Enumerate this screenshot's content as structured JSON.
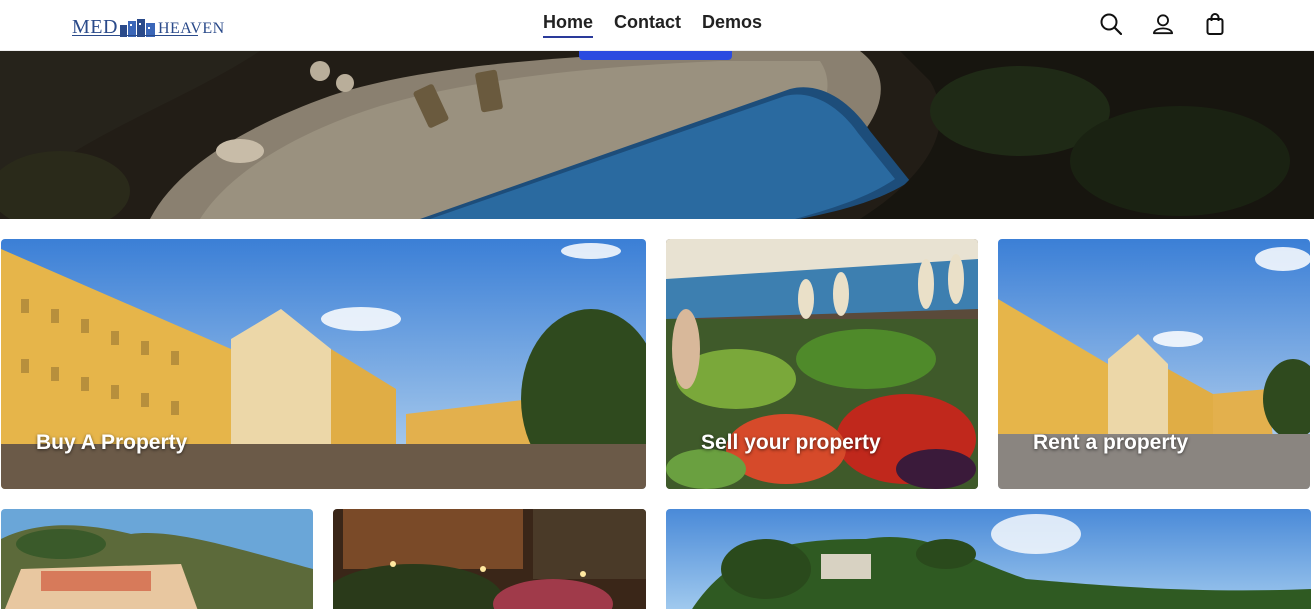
{
  "brand": {
    "logo_left": "MED",
    "logo_right": "HEAVEN",
    "primary_color": "#2b4be0",
    "logo_color": "#2a4a8a"
  },
  "nav": {
    "items": [
      {
        "label": "Home",
        "active": true
      },
      {
        "label": "Contact",
        "active": false
      },
      {
        "label": "Demos",
        "active": false
      }
    ]
  },
  "header_icons": [
    "search-icon",
    "account-icon",
    "cart-icon"
  ],
  "tiles": [
    {
      "label": "Buy A Property"
    },
    {
      "label": "Sell your property"
    },
    {
      "label": "Rent a property"
    },
    {
      "label": ""
    },
    {
      "label": ""
    },
    {
      "label": ""
    }
  ]
}
